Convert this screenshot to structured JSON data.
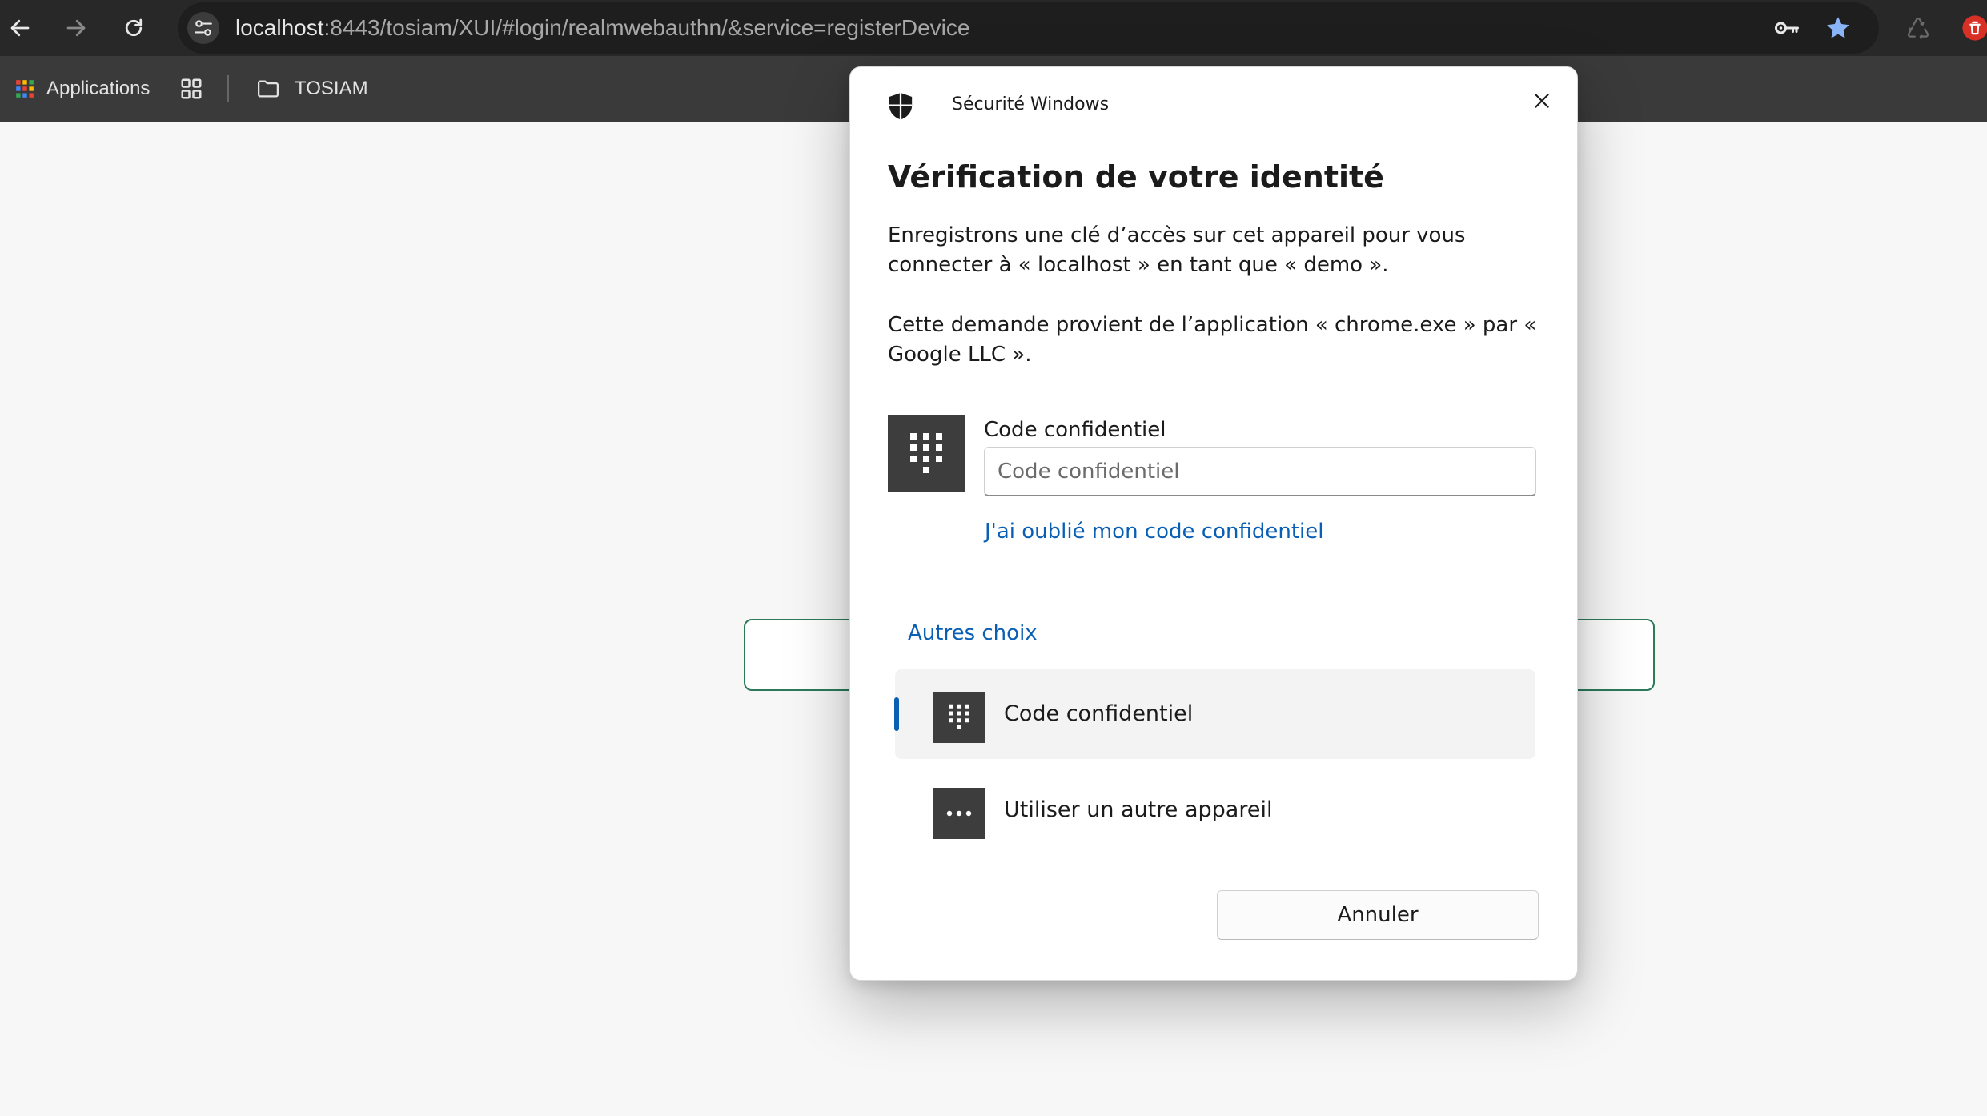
{
  "browser": {
    "url_host": "localhost",
    "url_rest": ":8443/tosiam/XUI/#login/realmwebauthn/&service=registerDevice",
    "bookmarks": {
      "apps_label": "Applications",
      "folder_label": "TOSIAM"
    }
  },
  "dialog": {
    "app_title": "Sécurité Windows",
    "heading": "Vérification de votre identité",
    "paragraph1": "Enregistrons une clé d’accès sur cet appareil pour vous connecter à « localhost » en tant que « demo ».",
    "paragraph2": "Cette demande provient de l’application « chrome.exe » par « Google LLC ».",
    "pin_label": "Code confidentiel",
    "pin_placeholder": "Code confidentiel",
    "pin_value": "",
    "forgot_link": "J'ai oublié mon code confidentiel",
    "other_choices_label": "Autres choix",
    "options": [
      {
        "label": "Code confidentiel",
        "icon": "keypad-icon",
        "selected": true
      },
      {
        "label": "Utiliser un autre appareil",
        "icon": "more-dots-icon",
        "selected": false
      }
    ],
    "cancel_label": "Annuler"
  },
  "colors": {
    "link": "#0a5fb4",
    "chrome_bg": "#282828",
    "bookmark_bar_bg": "#3a3a3a",
    "tile_bg": "#3d3d3d",
    "bookmark_star": "#8ab4f8",
    "extension_red": "#d93025"
  }
}
